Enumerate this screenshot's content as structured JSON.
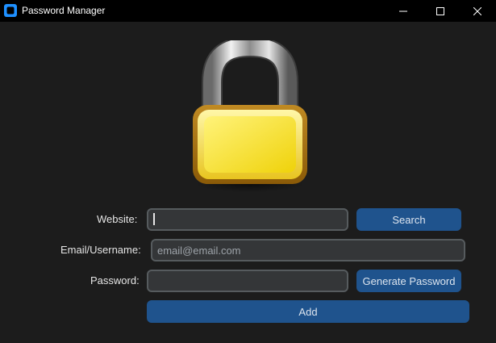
{
  "window": {
    "title": "Password Manager",
    "controls": [
      "minimize-icon",
      "maximize-icon",
      "close-icon"
    ]
  },
  "logo": {
    "icon": "padlock-icon"
  },
  "form": {
    "website": {
      "label": "Website:",
      "value": "",
      "placeholder": ""
    },
    "email": {
      "label": "Email/Username:",
      "value": "",
      "placeholder": "email@email.com"
    },
    "password": {
      "label": "Password:",
      "value": "",
      "placeholder": ""
    },
    "search_label": "Search",
    "generate_label": "Generate Password",
    "add_label": "Add"
  },
  "colors": {
    "background": "#1c1c1c",
    "titlebar": "#000000",
    "accent": "#1f538d",
    "field_bg": "#343638",
    "field_border": "#565b5e"
  }
}
